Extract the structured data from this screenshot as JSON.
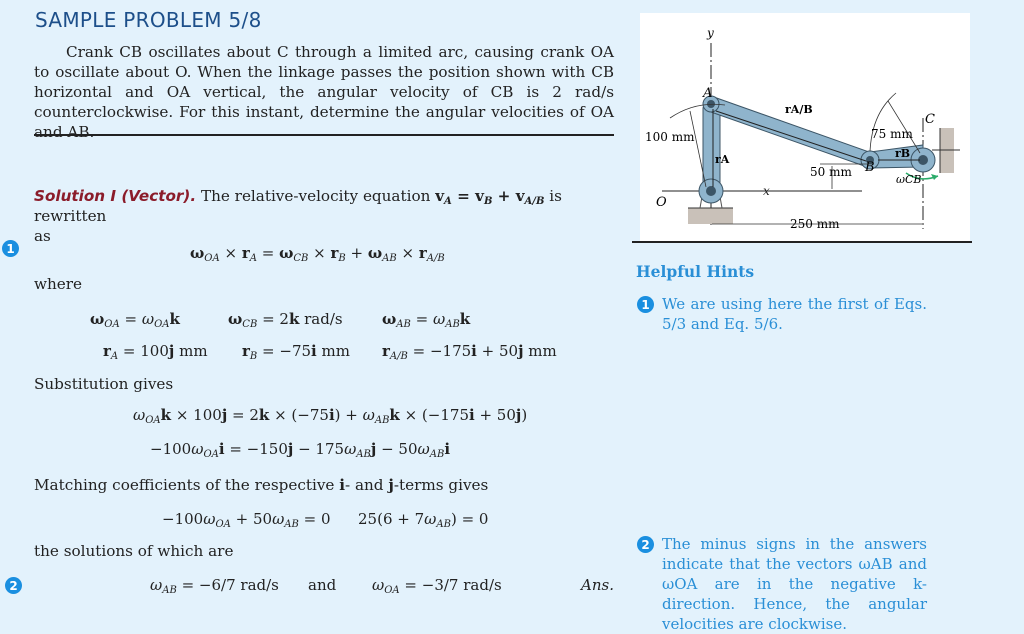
{
  "header": {
    "title": "SAMPLE PROBLEM 5/8"
  },
  "problem": {
    "statement": "Crank CB oscillates about C through a limited arc, causing crank OA to oscillate about O. When the linkage passes the position shown with CB horizontal and OA vertical, the angular velocity of CB is 2 rad/s counterclockwise. For this instant, determine the angular velocities of OA and AB."
  },
  "solution": {
    "heading": "Solution I (Vector).",
    "intro_text": "The relative-velocity equation",
    "intro_eq": "vA = vB + vA/B",
    "intro_tail": "is rewritten",
    "intro_as": "as",
    "eq1": "ωOA × rA = ωCB × rB + ωAB × rA/B",
    "where": "where",
    "defs_row1": [
      "ωOA = ωOA k",
      "ωCB = 2k rad/s",
      "ωAB = ωAB k"
    ],
    "defs_row2": [
      "rA = 100j mm",
      "rB = −75i mm",
      "rA/B = −175i + 50j mm"
    ],
    "substitution": "Substitution gives",
    "eq2": "ωOA k × 100j = 2k × (−75i) + ωAB k × (−175i + 50j)",
    "eq3": "−100ωOA i = −150j − 175ωAB j − 50ωAB i",
    "matching": "Matching coefficients of the respective i- and j-terms gives",
    "eq4a": "−100ωOA + 50ωAB = 0",
    "eq4b": "25(6 + 7ωAB) = 0",
    "solutions_text": "the solutions of which are",
    "answer_ab": "ωAB = −6/7 rad/s",
    "answer_and": "and",
    "answer_oa": "ωOA = −3/7 rad/s",
    "answer_label": "Ans."
  },
  "markers": [
    "1",
    "2"
  ],
  "figure": {
    "labels": {
      "y": "y",
      "x": "x",
      "A": "A",
      "B": "B",
      "C": "C",
      "O": "O",
      "rAB": "rA/B",
      "rA": "rA",
      "rB": "rB",
      "omegaCB": "ωCB",
      "dim_100": "100 mm",
      "dim_75": "75 mm",
      "dim_50": "50 mm",
      "dim_250": "250 mm"
    },
    "colors": {
      "link": "#8fb4cc",
      "link_stroke": "#3c5566",
      "arrow": "#2bab6a",
      "ground": "#c9c1b9"
    }
  },
  "hints": {
    "title": "Helpful Hints",
    "items": [
      {
        "num": "1",
        "text": "We are using here the first of Eqs. 5/3 and Eq. 5/6."
      },
      {
        "num": "2",
        "text": "The minus signs in the answers indicate that the vectors ωAB and ωOA are in the negative k-direction. Hence, the angular velocities are clockwise."
      }
    ]
  }
}
